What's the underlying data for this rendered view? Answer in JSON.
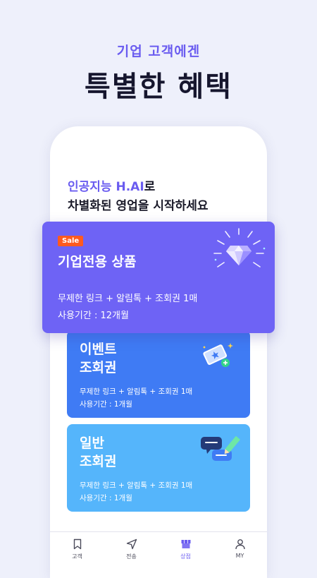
{
  "hero": {
    "subtitle": "기업 고객에겐",
    "title": "특별한 혜택"
  },
  "intro": {
    "highlight": "인공지능 H.AI",
    "highlight_suffix": "로",
    "line2": "차별화된 영업을 시작하세요"
  },
  "cards": {
    "sale": {
      "badge": "Sale",
      "title": "기업전용 상품",
      "line1": "무제한 링크 + 알림톡 + 조회권 1매",
      "line2": "사용기간 : 12개월",
      "icon": "diamond-icon"
    },
    "event": {
      "title_line1": "이벤트",
      "title_line2": "조회권",
      "line1": "무제한 링크 + 알림톡 + 조회권 1매",
      "line2": "사용기간 : 1개월",
      "icon": "ticket-icon"
    },
    "normal": {
      "title_line1": "일반",
      "title_line2": "조회권",
      "line1": "무제한 링크 + 알림톡 + 조회권 1매",
      "line2": "사용기간 : 1개월",
      "icon": "chat-pencil-icon"
    }
  },
  "nav": [
    {
      "label": "고객",
      "icon": "bookmark-icon"
    },
    {
      "label": "전송",
      "icon": "send-icon"
    },
    {
      "label": "상점",
      "icon": "store-icon"
    },
    {
      "label": "MY",
      "icon": "user-icon"
    }
  ],
  "colors": {
    "accent": "#6a5cf0",
    "sale_card": "#6e63f5",
    "event_card": "#3f7bf4",
    "normal_card": "#55b5fb",
    "badge": "#ff5a1f"
  }
}
